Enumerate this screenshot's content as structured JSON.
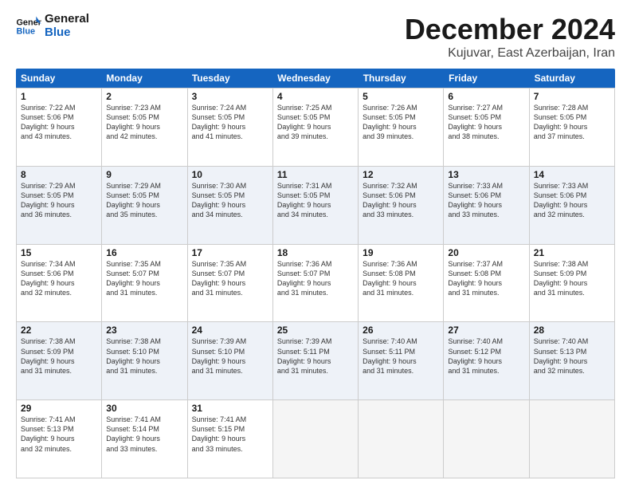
{
  "logo": {
    "line1": "General",
    "line2": "Blue"
  },
  "title": "December 2024",
  "subtitle": "Kujuvar, East Azerbaijan, Iran",
  "days_of_week": [
    "Sunday",
    "Monday",
    "Tuesday",
    "Wednesday",
    "Thursday",
    "Friday",
    "Saturday"
  ],
  "weeks": [
    [
      {
        "day": "1",
        "info": "Sunrise: 7:22 AM\nSunset: 5:06 PM\nDaylight: 9 hours\nand 43 minutes."
      },
      {
        "day": "2",
        "info": "Sunrise: 7:23 AM\nSunset: 5:05 PM\nDaylight: 9 hours\nand 42 minutes."
      },
      {
        "day": "3",
        "info": "Sunrise: 7:24 AM\nSunset: 5:05 PM\nDaylight: 9 hours\nand 41 minutes."
      },
      {
        "day": "4",
        "info": "Sunrise: 7:25 AM\nSunset: 5:05 PM\nDaylight: 9 hours\nand 39 minutes."
      },
      {
        "day": "5",
        "info": "Sunrise: 7:26 AM\nSunset: 5:05 PM\nDaylight: 9 hours\nand 39 minutes."
      },
      {
        "day": "6",
        "info": "Sunrise: 7:27 AM\nSunset: 5:05 PM\nDaylight: 9 hours\nand 38 minutes."
      },
      {
        "day": "7",
        "info": "Sunrise: 7:28 AM\nSunset: 5:05 PM\nDaylight: 9 hours\nand 37 minutes."
      }
    ],
    [
      {
        "day": "8",
        "info": "Sunrise: 7:29 AM\nSunset: 5:05 PM\nDaylight: 9 hours\nand 36 minutes."
      },
      {
        "day": "9",
        "info": "Sunrise: 7:29 AM\nSunset: 5:05 PM\nDaylight: 9 hours\nand 35 minutes."
      },
      {
        "day": "10",
        "info": "Sunrise: 7:30 AM\nSunset: 5:05 PM\nDaylight: 9 hours\nand 34 minutes."
      },
      {
        "day": "11",
        "info": "Sunrise: 7:31 AM\nSunset: 5:05 PM\nDaylight: 9 hours\nand 34 minutes."
      },
      {
        "day": "12",
        "info": "Sunrise: 7:32 AM\nSunset: 5:06 PM\nDaylight: 9 hours\nand 33 minutes."
      },
      {
        "day": "13",
        "info": "Sunrise: 7:33 AM\nSunset: 5:06 PM\nDaylight: 9 hours\nand 33 minutes."
      },
      {
        "day": "14",
        "info": "Sunrise: 7:33 AM\nSunset: 5:06 PM\nDaylight: 9 hours\nand 32 minutes."
      }
    ],
    [
      {
        "day": "15",
        "info": "Sunrise: 7:34 AM\nSunset: 5:06 PM\nDaylight: 9 hours\nand 32 minutes."
      },
      {
        "day": "16",
        "info": "Sunrise: 7:35 AM\nSunset: 5:07 PM\nDaylight: 9 hours\nand 31 minutes."
      },
      {
        "day": "17",
        "info": "Sunrise: 7:35 AM\nSunset: 5:07 PM\nDaylight: 9 hours\nand 31 minutes."
      },
      {
        "day": "18",
        "info": "Sunrise: 7:36 AM\nSunset: 5:07 PM\nDaylight: 9 hours\nand 31 minutes."
      },
      {
        "day": "19",
        "info": "Sunrise: 7:36 AM\nSunset: 5:08 PM\nDaylight: 9 hours\nand 31 minutes."
      },
      {
        "day": "20",
        "info": "Sunrise: 7:37 AM\nSunset: 5:08 PM\nDaylight: 9 hours\nand 31 minutes."
      },
      {
        "day": "21",
        "info": "Sunrise: 7:38 AM\nSunset: 5:09 PM\nDaylight: 9 hours\nand 31 minutes."
      }
    ],
    [
      {
        "day": "22",
        "info": "Sunrise: 7:38 AM\nSunset: 5:09 PM\nDaylight: 9 hours\nand 31 minutes."
      },
      {
        "day": "23",
        "info": "Sunrise: 7:38 AM\nSunset: 5:10 PM\nDaylight: 9 hours\nand 31 minutes."
      },
      {
        "day": "24",
        "info": "Sunrise: 7:39 AM\nSunset: 5:10 PM\nDaylight: 9 hours\nand 31 minutes."
      },
      {
        "day": "25",
        "info": "Sunrise: 7:39 AM\nSunset: 5:11 PM\nDaylight: 9 hours\nand 31 minutes."
      },
      {
        "day": "26",
        "info": "Sunrise: 7:40 AM\nSunset: 5:11 PM\nDaylight: 9 hours\nand 31 minutes."
      },
      {
        "day": "27",
        "info": "Sunrise: 7:40 AM\nSunset: 5:12 PM\nDaylight: 9 hours\nand 31 minutes."
      },
      {
        "day": "28",
        "info": "Sunrise: 7:40 AM\nSunset: 5:13 PM\nDaylight: 9 hours\nand 32 minutes."
      }
    ],
    [
      {
        "day": "29",
        "info": "Sunrise: 7:41 AM\nSunset: 5:13 PM\nDaylight: 9 hours\nand 32 minutes."
      },
      {
        "day": "30",
        "info": "Sunrise: 7:41 AM\nSunset: 5:14 PM\nDaylight: 9 hours\nand 33 minutes."
      },
      {
        "day": "31",
        "info": "Sunrise: 7:41 AM\nSunset: 5:15 PM\nDaylight: 9 hours\nand 33 minutes."
      },
      {
        "day": "",
        "info": ""
      },
      {
        "day": "",
        "info": ""
      },
      {
        "day": "",
        "info": ""
      },
      {
        "day": "",
        "info": ""
      }
    ]
  ]
}
